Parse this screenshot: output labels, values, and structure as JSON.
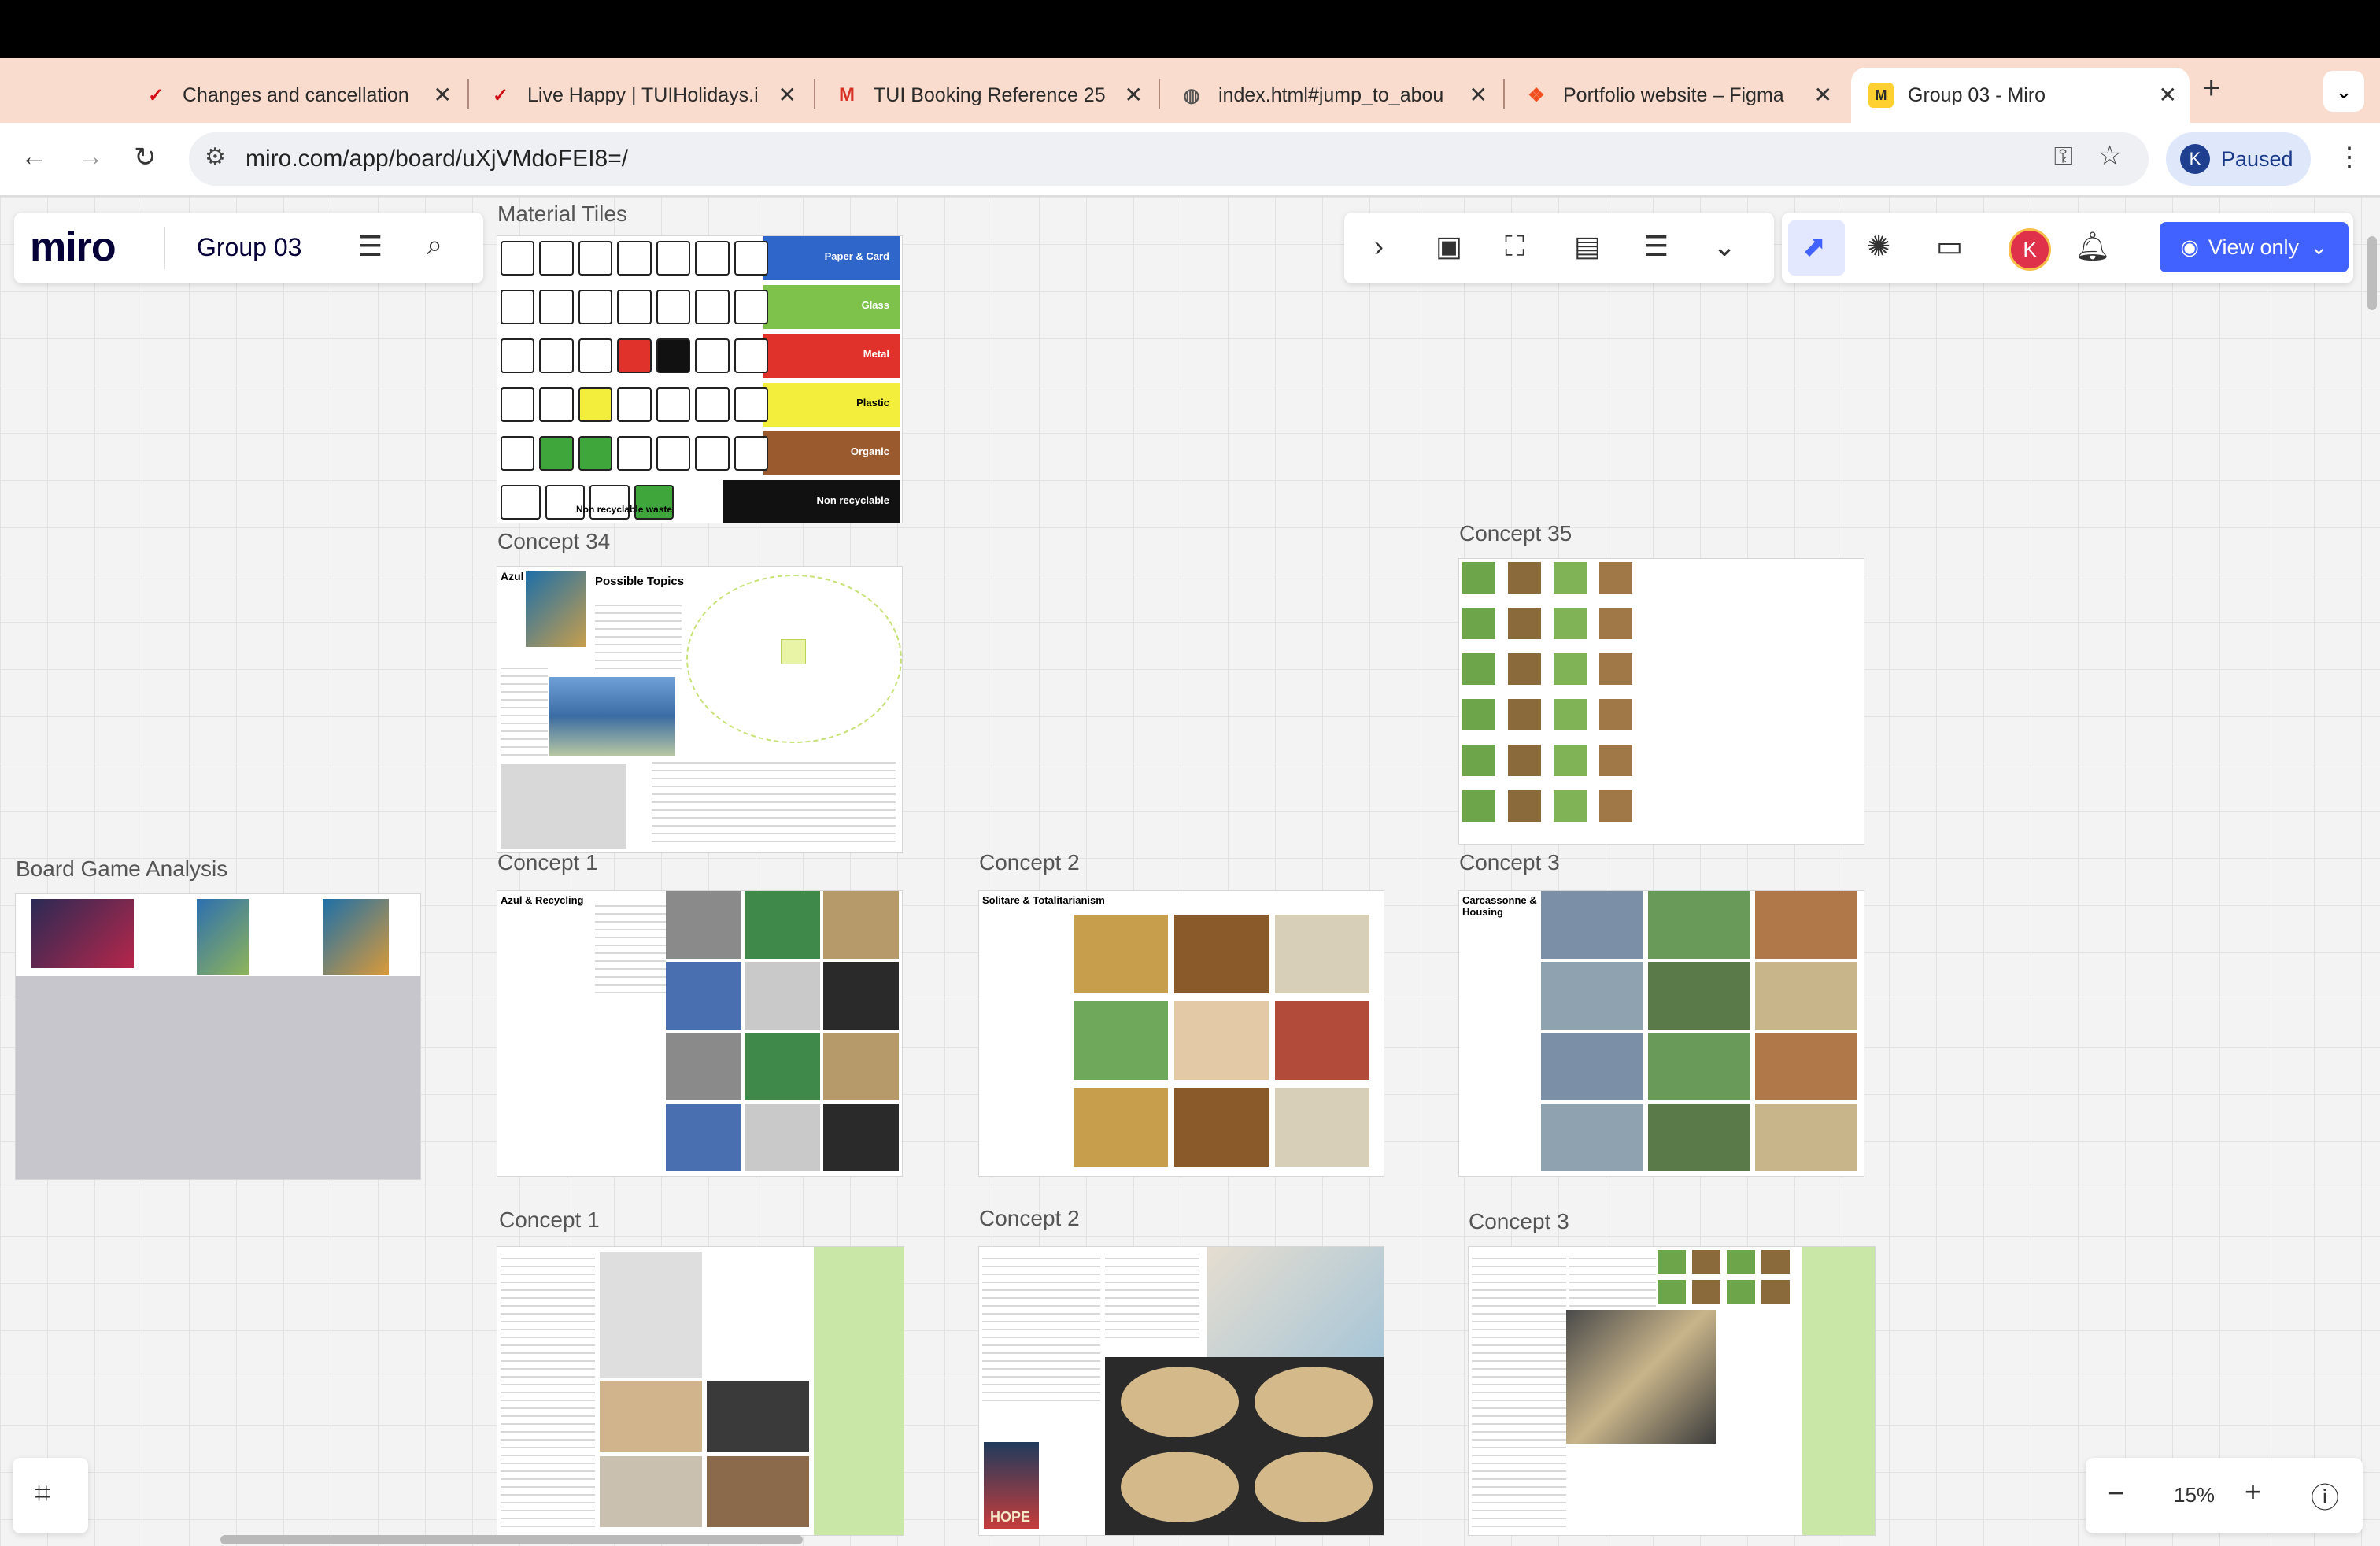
{
  "browser": {
    "tabs": [
      {
        "title": "Changes and cancellation",
        "favicon": "tui-icon"
      },
      {
        "title": "Live Happy | TUIHolidays.i",
        "favicon": "tui-icon"
      },
      {
        "title": "TUI Booking Reference 25",
        "favicon": "gmail-icon"
      },
      {
        "title": "index.html#jump_to_abou",
        "favicon": "globe-icon"
      },
      {
        "title": "Portfolio website – Figma",
        "favicon": "figma-icon"
      },
      {
        "title": "Group 03 - Miro",
        "favicon": "miro-icon"
      }
    ],
    "url": "miro.com/app/board/uXjVMdoFEI8=/",
    "profile_initial": "K",
    "profile_label": "Paused"
  },
  "miro": {
    "logo": "miro",
    "board_name": "Group 03",
    "view_only_label": "View only",
    "user_initial": "K",
    "zoom": "15%",
    "colors": {
      "accent": "#4262ff",
      "user": "#e0314b"
    }
  },
  "frames": {
    "material_tiles": "Material Tiles",
    "concept34": "Concept 34",
    "concept35": "Concept 35",
    "board_game_analysis": "Board Game Analysis",
    "concept1_top": "Concept 1",
    "concept2_top": "Concept 2",
    "concept3_top": "Concept 3",
    "concept1_bottom": "Concept 1",
    "concept2_bottom": "Concept 2",
    "concept3_bottom": "Concept 3"
  },
  "material_bars": [
    {
      "label": "Paper & Card",
      "color": "#2f66c9"
    },
    {
      "label": "Glass",
      "color": "#7fc24b"
    },
    {
      "label": "Metal",
      "color": "#e0312a"
    },
    {
      "label": "Plastic",
      "color": "#f2ee3b"
    },
    {
      "label": "Organic",
      "color": "#9b5a2e"
    },
    {
      "label": "Non recyclable",
      "color": "#111111"
    }
  ],
  "frame_text": {
    "azul": "Azul",
    "possible_topics": "Possible Topics",
    "azul_recycling": "Azul & Recycling",
    "solitaire": "Solitare & Totalitarianism",
    "carcassonne": "Carcassonne & Housing",
    "non_recyclable_waste": "Non recyclable waste",
    "hope": "HOPE"
  }
}
